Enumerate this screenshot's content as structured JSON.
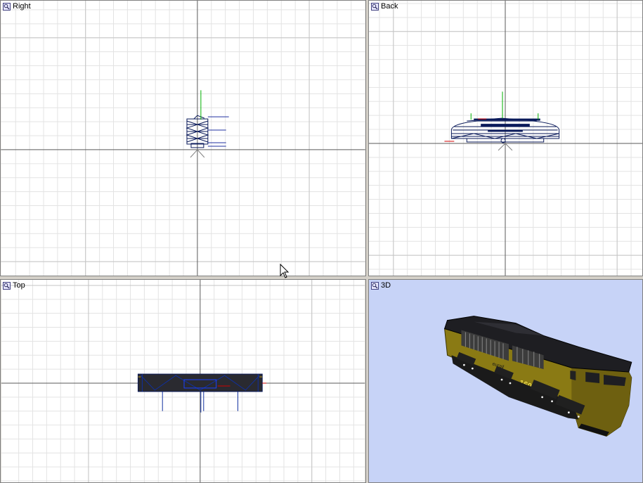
{
  "viewports": [
    {
      "id": "right",
      "title": "Right"
    },
    {
      "id": "back",
      "title": "Back"
    },
    {
      "id": "top",
      "title": "Top"
    },
    {
      "id": "3d",
      "title": "3D"
    }
  ],
  "model": {
    "number_label": "1606",
    "body_color": "#8a7a14",
    "roof_color": "#1a1a1a"
  },
  "colors": {
    "grid_minor": "#dcdcdc",
    "grid_major": "#9a9a9a",
    "axis": "#505050",
    "wire": "#0a1a5a",
    "y_axis": "#00b000",
    "x_axis": "#d00000",
    "bg_3d": "#c7d3f7"
  },
  "icons": {
    "viewport_menu": "magnifier-icon",
    "cursor": "mouse-pointer-icon"
  }
}
